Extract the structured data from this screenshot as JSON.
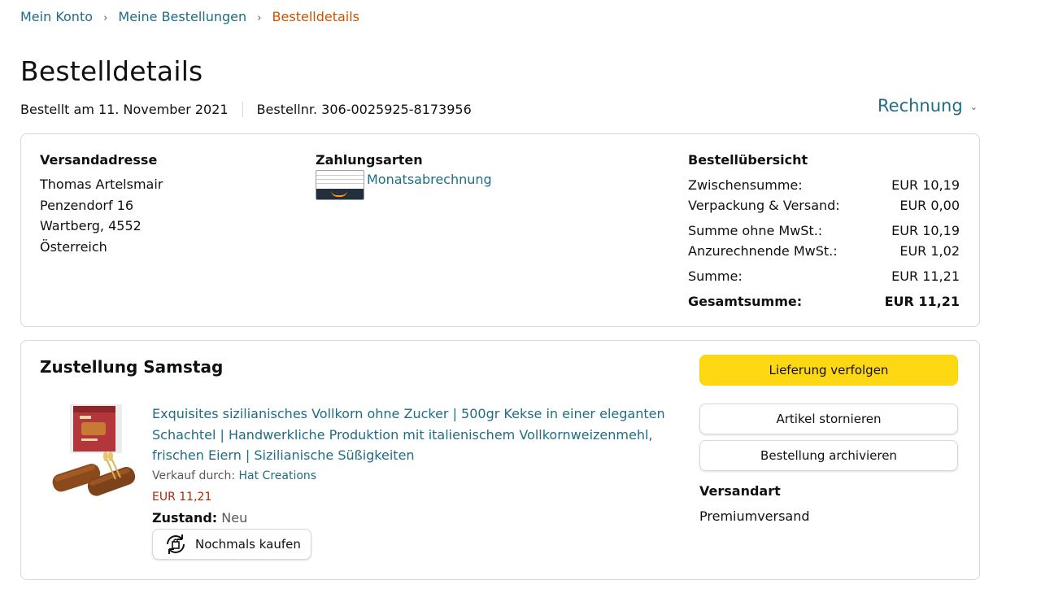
{
  "breadcrumb": {
    "items": [
      "Mein Konto",
      "Meine Bestellungen"
    ],
    "current": "Bestelldetails",
    "separator": "›"
  },
  "page": {
    "title": "Bestelldetails",
    "ordered_on": "Bestellt am 11. November 2021",
    "order_number": "Bestellnr. 306-0025925-8173956",
    "invoice_label": "Rechnung"
  },
  "shipping_address": {
    "title": "Versandadresse",
    "lines": [
      "Thomas Artelsmair",
      "Penzendorf 16",
      "Wartberg, 4552",
      "Österreich"
    ]
  },
  "payment": {
    "title": "Zahlungsarten",
    "method": "Monatsabrechnung",
    "icon": "payment-card-icon"
  },
  "summary": {
    "title": "Bestellübersicht",
    "rows": [
      {
        "label": "Zwischensumme:",
        "value": "EUR 10,19"
      },
      {
        "label": "Verpackung & Versand:",
        "value": "EUR 0,00"
      },
      {
        "label": "Summe ohne MwSt.:",
        "value": "EUR 10,19"
      },
      {
        "label": "Anzurechnende MwSt.:",
        "value": "EUR 1,02"
      },
      {
        "label": "Summe:",
        "value": "EUR 11,21"
      }
    ],
    "total": {
      "label": "Gesamtsumme:",
      "value": "EUR 11,21"
    }
  },
  "delivery": {
    "title": "Zustellung Samstag",
    "product": {
      "title": "Exquisites sizilianisches Vollkorn ohne Zucker | 500gr Kekse in einer eleganten Schachtel | Handwerkliche Produktion mit italienischem Vollkornweizenmehl, frischen Eiern | Sizilianische Süßigkeiten",
      "seller_label": "Verkauf durch:",
      "seller": "Hat Creations",
      "price": "EUR 11,21",
      "condition_label": "Zustand:",
      "condition": "Neu",
      "buy_again_label": "Nochmals kaufen"
    },
    "actions": {
      "track": "Lieferung verfolgen",
      "cancel": "Artikel stornieren",
      "archive": "Bestellung archivieren"
    },
    "shipping_type_label": "Versandart",
    "shipping_type": "Premiumversand"
  },
  "colors": {
    "link": "#1f6c83",
    "breadcrumb_current": "#c45500",
    "price": "#b12704",
    "primary_button": "#ffd814",
    "border": "#d5d9d9"
  }
}
